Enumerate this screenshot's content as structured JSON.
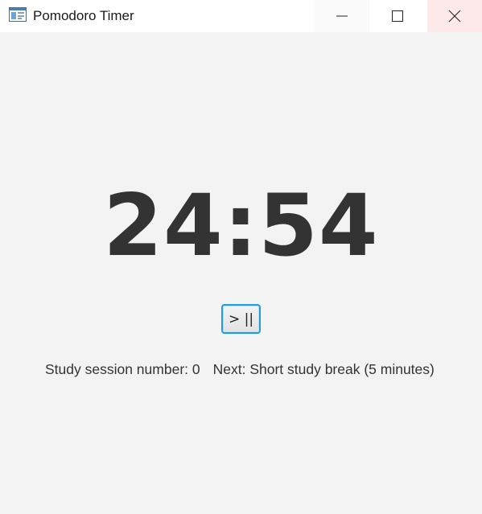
{
  "window": {
    "title": "Pomodoro Timer",
    "app_icon": "window-app-icon",
    "controls": {
      "minimize_icon": "minimize-icon",
      "maximize_icon": "maximize-icon",
      "close_icon": "close-icon"
    }
  },
  "timer": {
    "display": "24:54"
  },
  "toggle_button": {
    "label": "> ||"
  },
  "status": {
    "session_text": "Study session number: 0",
    "next_text": "Next: Short study break (5 minutes)"
  },
  "colors": {
    "background": "#f3f3f3",
    "titlebar": "#ffffff",
    "clock_text": "#333333",
    "button_focus_border": "#1e9fdc",
    "close_hover": "#fde9e9"
  }
}
